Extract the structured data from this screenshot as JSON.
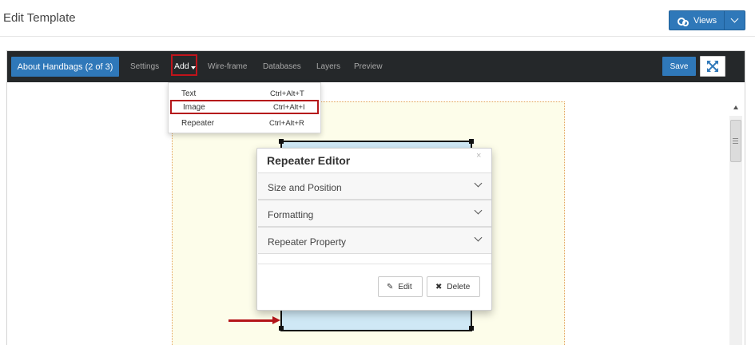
{
  "header": {
    "title": "Edit Template",
    "views_label": "Views",
    "views_icon": "gears-icon"
  },
  "toolbar": {
    "crumb_label": "About Handbags (2 of 3)",
    "settings_label": "Settings",
    "add_label": "Add",
    "wireframe_label": "Wire-frame",
    "databases_label": "Databases",
    "layers_label": "Layers",
    "preview_label": "Preview",
    "save_label": "Save",
    "fullscreen_icon": "expand-icon"
  },
  "add_menu": {
    "items": [
      {
        "label": "Text",
        "shortcut": "Ctrl+Alt+T"
      },
      {
        "label": "Image",
        "shortcut": "Ctrl+Alt+I"
      },
      {
        "label": "Repeater",
        "shortcut": "Ctrl+Alt+R"
      }
    ]
  },
  "repeater_editor": {
    "title": "Repeater Editor",
    "close": "×",
    "sections": [
      {
        "label": "Size and Position"
      },
      {
        "label": "Formatting"
      },
      {
        "label": "Repeater Property"
      }
    ],
    "edit_label": "Edit",
    "delete_label": "Delete"
  },
  "colors": {
    "accent": "#2f78b9",
    "toolbar_bg": "#25282a",
    "highlight_red": "#b5161a",
    "canvas_bg": "#fdfdea",
    "repeater_fill": "#cfe8f5"
  }
}
